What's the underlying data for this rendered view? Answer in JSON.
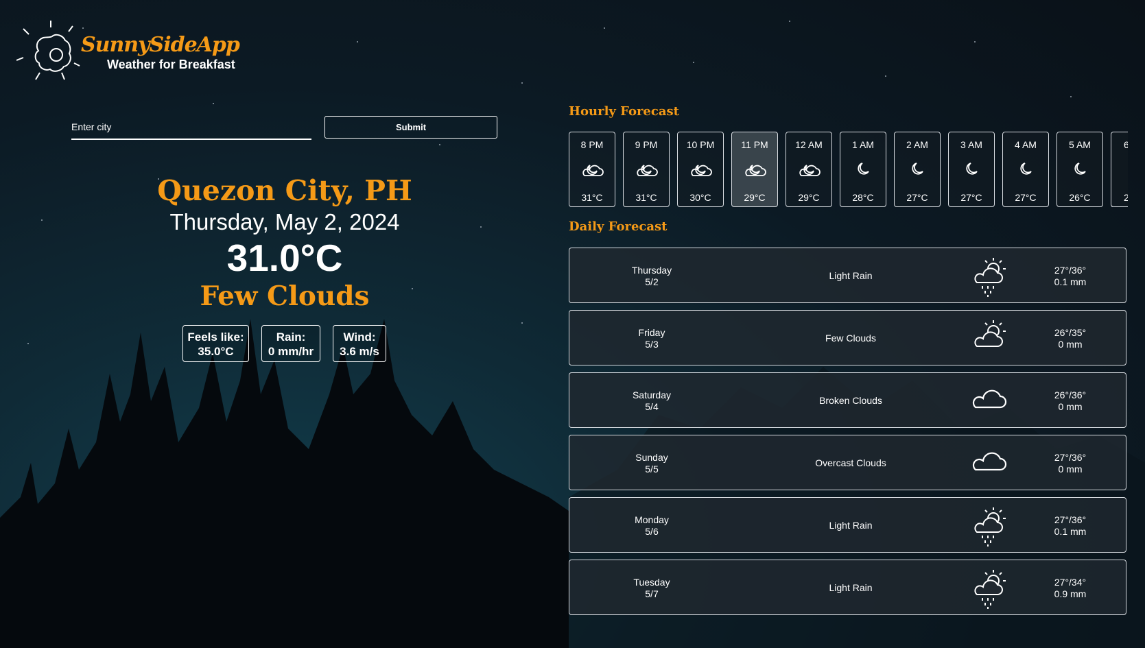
{
  "brand": {
    "name": "SunnySideApp",
    "tagline": "Weather for Breakfast"
  },
  "search": {
    "placeholder": "Enter city",
    "submit_label": "Submit"
  },
  "current": {
    "city": "Quezon City, PH",
    "date": "Thursday, May 2, 2024",
    "temperature": "31.0°C",
    "description": "Few Clouds",
    "stats": [
      {
        "label": "Feels like:",
        "value": "35.0°C"
      },
      {
        "label": "Rain:",
        "value": "0 mm/hr"
      },
      {
        "label": "Wind:",
        "value": "3.6 m/s"
      }
    ]
  },
  "hourly": {
    "title": "Hourly Forecast",
    "items": [
      {
        "time": "8 PM",
        "icon": "partly-cloudy-night-icon",
        "temp": "31°C"
      },
      {
        "time": "9 PM",
        "icon": "partly-cloudy-night-icon",
        "temp": "31°C"
      },
      {
        "time": "10 PM",
        "icon": "partly-cloudy-night-icon",
        "temp": "30°C"
      },
      {
        "time": "11 PM",
        "icon": "partly-cloudy-night-icon",
        "temp": "29°C"
      },
      {
        "time": "12 AM",
        "icon": "partly-cloudy-night-icon",
        "temp": "29°C"
      },
      {
        "time": "1 AM",
        "icon": "moon-icon",
        "temp": "28°C"
      },
      {
        "time": "2 AM",
        "icon": "moon-icon",
        "temp": "27°C"
      },
      {
        "time": "3 AM",
        "icon": "moon-icon",
        "temp": "27°C"
      },
      {
        "time": "4 AM",
        "icon": "moon-icon",
        "temp": "27°C"
      },
      {
        "time": "5 AM",
        "icon": "moon-icon",
        "temp": "26°C"
      },
      {
        "time": "6",
        "icon": "moon-icon",
        "temp": "2"
      }
    ]
  },
  "daily": {
    "title": "Daily Forecast",
    "items": [
      {
        "day": "Thursday",
        "date": "5/2",
        "description": "Light Rain",
        "icon": "sun-cloud-rain-icon",
        "temps": "27°/36°",
        "rain": "0.1 mm"
      },
      {
        "day": "Friday",
        "date": "5/3",
        "description": "Few Clouds",
        "icon": "sun-cloud-icon",
        "temps": "26°/35°",
        "rain": "0 mm"
      },
      {
        "day": "Saturday",
        "date": "5/4",
        "description": "Broken Clouds",
        "icon": "cloud-icon",
        "temps": "26°/36°",
        "rain": "0 mm"
      },
      {
        "day": "Sunday",
        "date": "5/5",
        "description": "Overcast Clouds",
        "icon": "cloud-icon",
        "temps": "27°/36°",
        "rain": "0 mm"
      },
      {
        "day": "Monday",
        "date": "5/6",
        "description": "Light Rain",
        "icon": "sun-cloud-rain-icon",
        "temps": "27°/36°",
        "rain": "0.1 mm"
      },
      {
        "day": "Tuesday",
        "date": "5/7",
        "description": "Light Rain",
        "icon": "sun-cloud-rain-icon",
        "temps": "27°/34°",
        "rain": "0.9 mm"
      }
    ]
  },
  "colors": {
    "accent": "#f59a17",
    "background": "#0c1a24",
    "card": "#202830"
  }
}
